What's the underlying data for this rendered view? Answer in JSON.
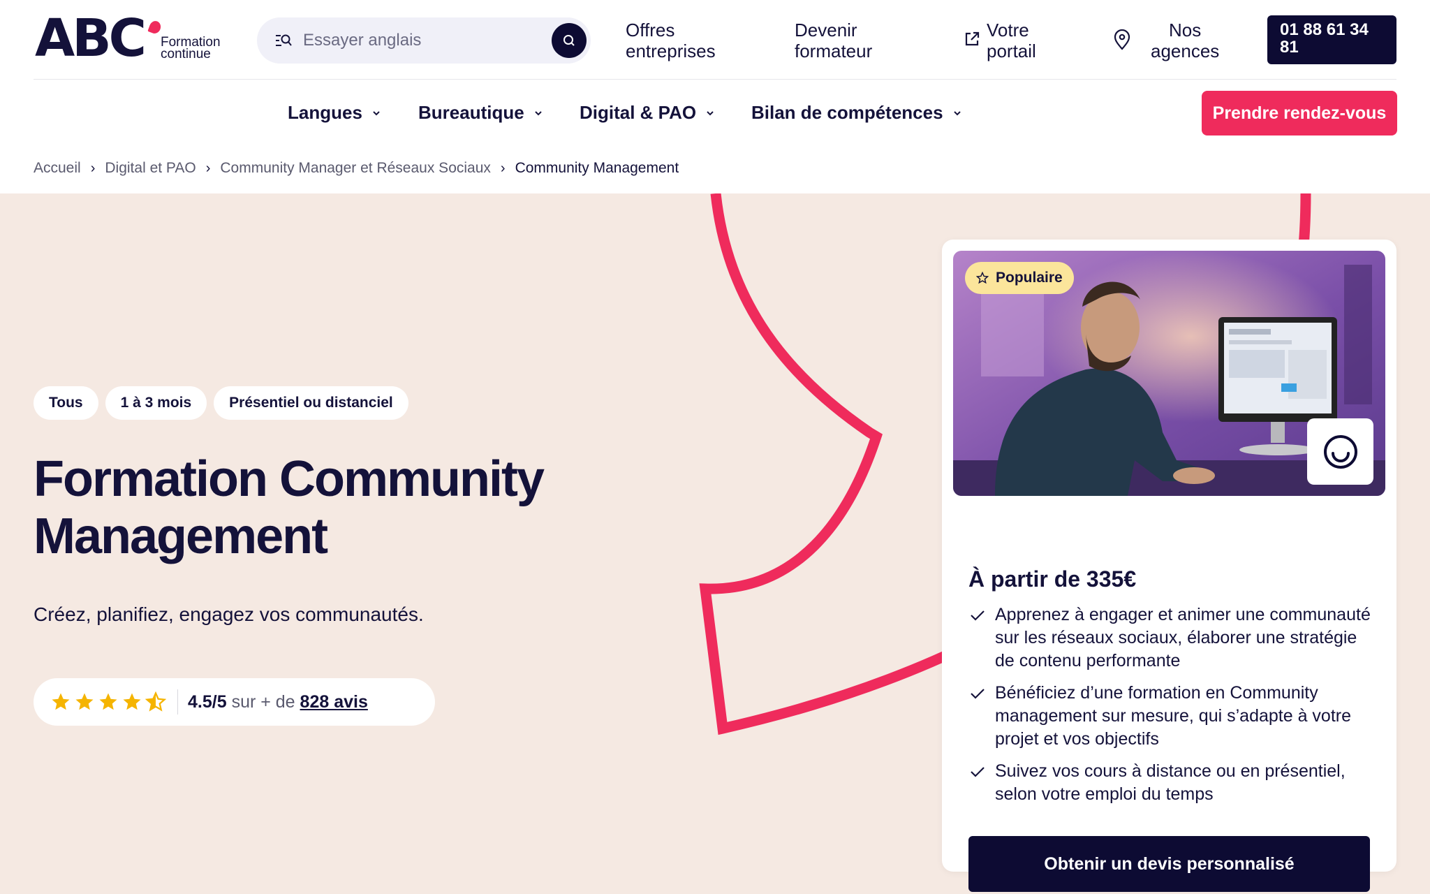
{
  "brand": {
    "logo_text": "ABC",
    "logo_sub_line1": "Formation",
    "logo_sub_line2": "continue",
    "accent_color": "#ef2b5c",
    "dark_color": "#0d0b33",
    "hero_bg_color": "#f5e9e2"
  },
  "search": {
    "placeholder": "Essayer anglais",
    "value": ""
  },
  "toplinks": {
    "offres_line1": "Offres",
    "offres_line2": "entreprises",
    "formateur_line1": "Devenir",
    "formateur_line2": "formateur",
    "portail_line1": "Votre",
    "portail_line2": "portail",
    "agences_line1": "Nos",
    "agences_line2": "agences",
    "phone_line1": "01 88 61 34",
    "phone_line2": "81"
  },
  "nav": {
    "items": [
      {
        "label": "Langues"
      },
      {
        "label": "Bureautique"
      },
      {
        "label": "Digital & PAO"
      },
      {
        "label": "Bilan de compétences"
      }
    ],
    "cta": "Prendre rendez-vous"
  },
  "breadcrumb": {
    "items": [
      {
        "label": "Accueil"
      },
      {
        "label": "Digital et PAO"
      },
      {
        "label": "Community Manager et Réseaux Sociaux"
      },
      {
        "label": "Community Management"
      }
    ]
  },
  "hero": {
    "chips": [
      "Tous",
      "1 à 3 mois",
      "Présentiel ou distanciel"
    ],
    "title_line1": "Formation Community",
    "title_line2": "Management",
    "subtitle": "Créez, planifiez, engagez vos communautés.",
    "rating": {
      "stars": 4.5,
      "score": "4.5/5",
      "middle": "sur + de",
      "reviews_link": "828 avis"
    }
  },
  "card": {
    "badge": "Populaire",
    "image_icon": "smile-icon",
    "price": "À partir de 335€",
    "benefits": [
      "Apprenez à engager et animer une communauté sur les réseaux sociaux, élaborer une stratégie de contenu performante",
      "Bénéficiez d’une formation en Community management sur mesure, qui s’adapte à votre projet et vos objectifs",
      "Suivez vos cours à distance ou en présentiel, selon votre emploi du temps"
    ],
    "cta": "Obtenir un devis personnalisé"
  },
  "icons": {
    "search": "search-icon",
    "search_submit": "magnifier-icon",
    "portal": "external-link-icon",
    "agencies": "map-pin-icon",
    "chevron": "chevron-down-icon",
    "breadcrumb_sep": "chevron-right-icon",
    "star": "star-icon",
    "check": "check-icon"
  }
}
